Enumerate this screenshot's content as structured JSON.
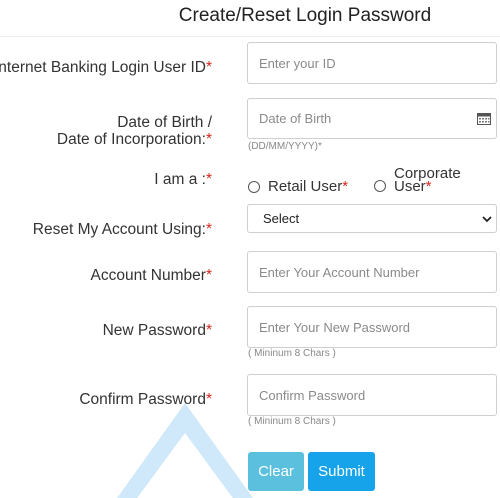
{
  "header": {
    "title": "Create/Reset Login Password"
  },
  "form": {
    "user_id": {
      "label": "Internet Banking Login User ID",
      "required": "*",
      "placeholder": "Enter your ID"
    },
    "dob": {
      "label_line1": "Date of Birth /",
      "label_line2": "Date of Incorporation:",
      "required": "*",
      "placeholder": "Date of Birth",
      "hint": "(DD/MM/YYYY)*",
      "icon": "calendar-icon"
    },
    "user_type": {
      "label": "I am a :",
      "required": "*",
      "options": [
        {
          "label": "Retail User",
          "required": "*"
        },
        {
          "label_line1": "Corporate",
          "label_line2": "User",
          "required": "*"
        }
      ]
    },
    "reset_using": {
      "label": "Reset My Account Using:",
      "required": "*",
      "selected": "Select"
    },
    "account_number": {
      "label": "Account Number",
      "required": "*",
      "placeholder": "Enter Your Account Number"
    },
    "new_password": {
      "label": "New Password",
      "required": "*",
      "placeholder": "Enter Your New Password",
      "hint": "( Mininum 8 Chars )"
    },
    "confirm_password": {
      "label": "Confirm Password",
      "required": "*",
      "placeholder": "Confirm Password",
      "hint": "( Mininum 8 Chars )"
    }
  },
  "buttons": {
    "clear": "Clear",
    "submit": "Submit"
  },
  "colors": {
    "required": "#d9261c",
    "clear_button": "#5bc0de",
    "submit_button": "#16a3e9",
    "watermark": "#cfe9fa"
  }
}
